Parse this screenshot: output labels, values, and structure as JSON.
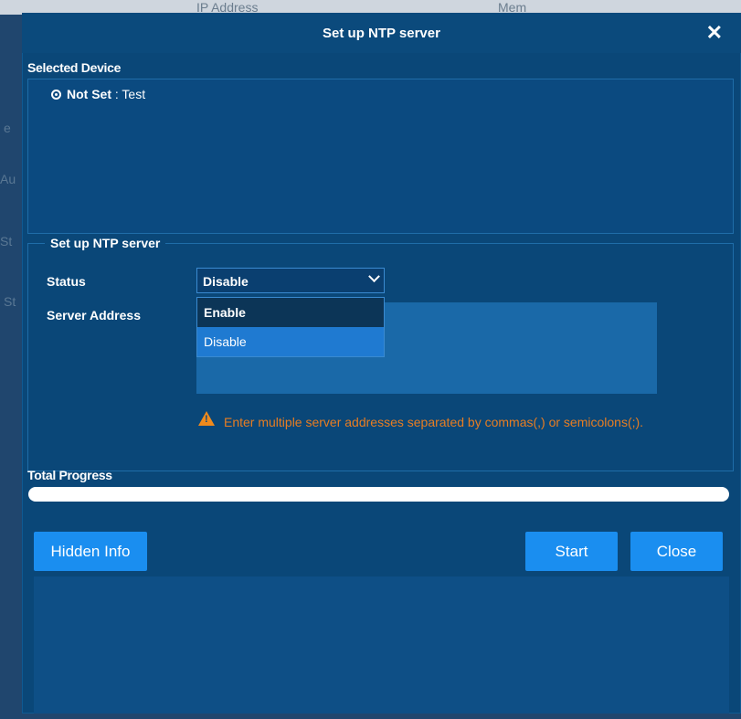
{
  "background": {
    "top_text_left": "IP Address",
    "top_text_right": "Mem",
    "side_fragments": [
      "e",
      "Au",
      "St",
      "St"
    ]
  },
  "dialog": {
    "title": "Set up NTP server",
    "close_icon": "close-icon",
    "selected_device_label": "Selected Device",
    "device": {
      "name": "Not Set",
      "separator": " : ",
      "value": "Test"
    },
    "ntp_section": {
      "legend": "Set up NTP server",
      "status_label": "Status",
      "status_value": "Disable",
      "status_options": [
        "Enable",
        "Disable"
      ],
      "server_address_label": "Server Address",
      "server_address_value": "",
      "warning_text": "Enter multiple server addresses separated by commas(,) or semicolons(;)."
    },
    "progress_label": "Total Progress",
    "progress_value": 0,
    "buttons": {
      "hidden_info": "Hidden Info",
      "start": "Start",
      "close": "Close"
    }
  },
  "colors": {
    "dialog_bg": "#0a4778",
    "button": "#1a8ef0",
    "warning": "#e77d22",
    "dropdown_selected": "#1f7ad1"
  }
}
